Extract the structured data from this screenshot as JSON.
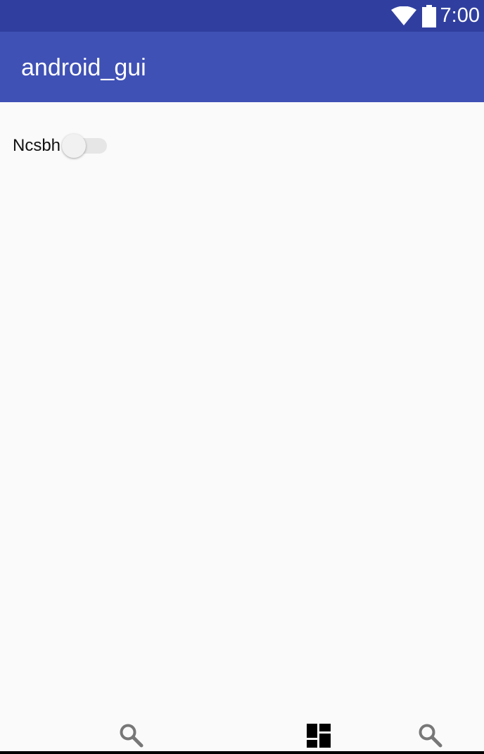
{
  "status_bar": {
    "time": "7:00",
    "icons": [
      "wifi-icon",
      "battery-icon"
    ],
    "background": "#303f9f"
  },
  "app_bar": {
    "title": "android_gui",
    "background": "#3f51b5"
  },
  "content": {
    "switch": {
      "label": "Ncsbh",
      "checked": false
    }
  },
  "bottom_nav": {
    "items": [
      {
        "icon": "search-icon"
      },
      {
        "icon": "dashboard-icon"
      },
      {
        "icon": "search-icon"
      }
    ]
  }
}
